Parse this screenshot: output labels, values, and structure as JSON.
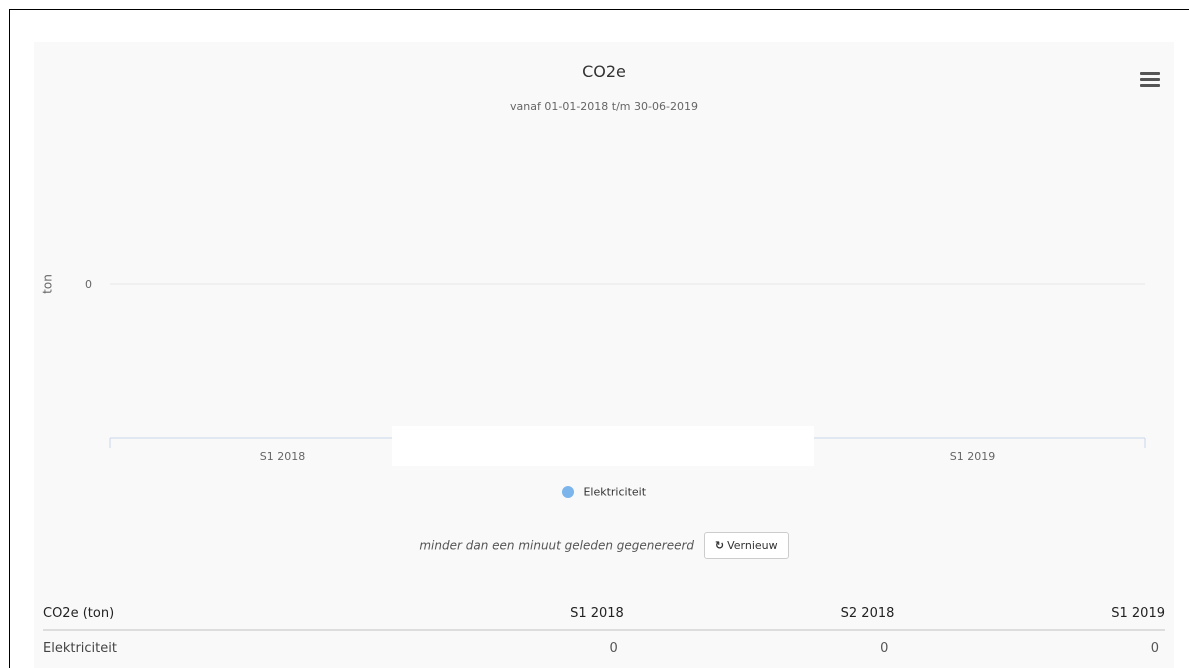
{
  "menu_icon": "hamburger-menu-icon",
  "chart_data": {
    "type": "bar",
    "title": "CO2e",
    "subtitle": "vanaf 01-01-2018 t/m 30-06-2019",
    "ylabel": "ton",
    "xlabel": "",
    "categories": [
      "S1 2018",
      "S2 2018",
      "S1 2019"
    ],
    "visible_tick_labels": [
      "S1 2018",
      "S1 2019"
    ],
    "y_ticks": [
      0
    ],
    "series": [
      {
        "name": "Elektriciteit",
        "values": [
          0,
          0,
          0
        ],
        "color": "#7cb5ec"
      }
    ],
    "legend_position": "bottom-center",
    "grid": true
  },
  "generated": {
    "text": "minder dan een minuut geleden gegenereerd",
    "button_label": "Vernieuw",
    "button_icon": "refresh-icon"
  },
  "table": {
    "header": [
      "CO2e (ton)",
      "S1 2018",
      "S2 2018",
      "S1 2019"
    ],
    "rows": [
      [
        "Elektriciteit",
        "0",
        "0",
        "0"
      ]
    ]
  }
}
